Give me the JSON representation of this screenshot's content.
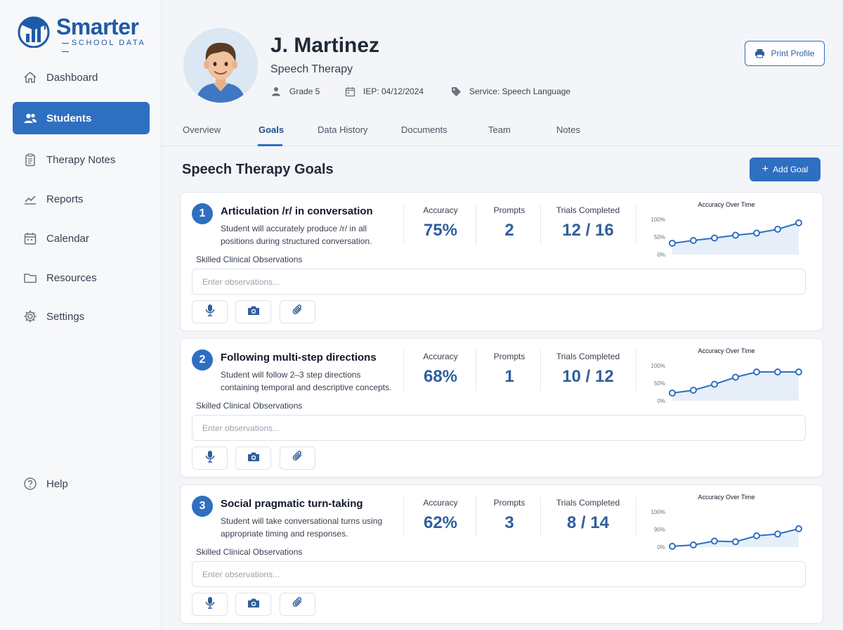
{
  "brand": {
    "name": "Smarter",
    "subtitle": "SCHOOL DATA"
  },
  "sidebar": {
    "items": [
      {
        "label": "Dashboard",
        "icon": "home-icon"
      },
      {
        "label": "Students",
        "icon": "users-icon",
        "active": true
      },
      {
        "label": "Therapy Notes",
        "icon": "clipboard-icon"
      },
      {
        "label": "Reports",
        "icon": "trend-chart-icon"
      },
      {
        "label": "Calendar",
        "icon": "calendar-icon"
      },
      {
        "label": "Resources",
        "icon": "folder-icon"
      },
      {
        "label": "Settings",
        "icon": "gear-icon"
      }
    ],
    "help": {
      "label": "Help",
      "icon": "help-icon"
    }
  },
  "student": {
    "name": "J. Martinez",
    "program": "Speech Therapy",
    "grade": "Grade 5",
    "iep": "IEP: 04/12/2024",
    "service": "Service: Speech Language"
  },
  "header": {
    "print_label": "Print Profile"
  },
  "tabs": [
    {
      "label": "Overview"
    },
    {
      "label": "Goals",
      "active": true
    },
    {
      "label": "Data History"
    },
    {
      "label": "Documents"
    },
    {
      "label": "Team"
    },
    {
      "label": "Notes"
    }
  ],
  "main": {
    "section_title": "Speech Therapy Goals",
    "add_goal_label": "Add Goal"
  },
  "goal_labels": {
    "accuracy": "Accuracy",
    "prompts": "Prompts",
    "trials": "Trials Completed",
    "observations": "Skilled Clinical Observations",
    "observations_placeholder": "Enter observations...",
    "chart_title": "Accuracy Over Time"
  },
  "colors": {
    "accent": "#2f6fc2",
    "value_text": "#2f5f9e",
    "chart_fill": "#e6eef8"
  },
  "goals": [
    {
      "number": "1",
      "title": "Articulation /r/ in conversation",
      "desc": "Student will accurately produce /r/ in all positions during structured conversation.",
      "accuracy": "75%",
      "prompts": "2",
      "trials": "12 / 16",
      "y_ticks": [
        "100%",
        "50%",
        "0%"
      ]
    },
    {
      "number": "2",
      "title": "Following multi-step directions",
      "desc": "Student will follow 2–3 step directions containing temporal and descriptive concepts.",
      "accuracy": "68%",
      "prompts": "1",
      "trials": "10 / 12",
      "y_ticks": [
        "100%",
        "50%",
        "0%"
      ]
    },
    {
      "number": "3",
      "title": "Social pragmatic turn-taking",
      "desc": "Student will take conversational turns using appropriate timing and responses.",
      "accuracy": "62%",
      "prompts": "3",
      "trials": "8 / 14",
      "y_ticks": [
        "100%",
        "90%",
        "0%"
      ]
    }
  ],
  "chart_data": [
    {
      "type": "line",
      "title": "Accuracy Over Time",
      "ylim": [
        0,
        100
      ],
      "yticks": [
        "100%",
        "50%",
        "0%"
      ],
      "x": [
        1,
        2,
        3,
        4,
        5,
        6,
        7
      ],
      "values": [
        32,
        40,
        47,
        55,
        61,
        72,
        90
      ]
    },
    {
      "type": "line",
      "title": "Accuracy Over Time",
      "ylim": [
        0,
        100
      ],
      "yticks": [
        "100%",
        "50%",
        "0%"
      ],
      "x": [
        1,
        2,
        3,
        4,
        5,
        6,
        7
      ],
      "values": [
        22,
        30,
        47,
        67,
        82,
        82,
        82
      ]
    },
    {
      "type": "line",
      "title": "Accuracy Over Time",
      "ylim": [
        0,
        100
      ],
      "yticks": [
        "100%",
        "90%",
        "0%"
      ],
      "x": [
        1,
        2,
        3,
        4,
        5,
        6,
        7
      ],
      "values": [
        2,
        6,
        17,
        15,
        32,
        37,
        52
      ]
    }
  ]
}
